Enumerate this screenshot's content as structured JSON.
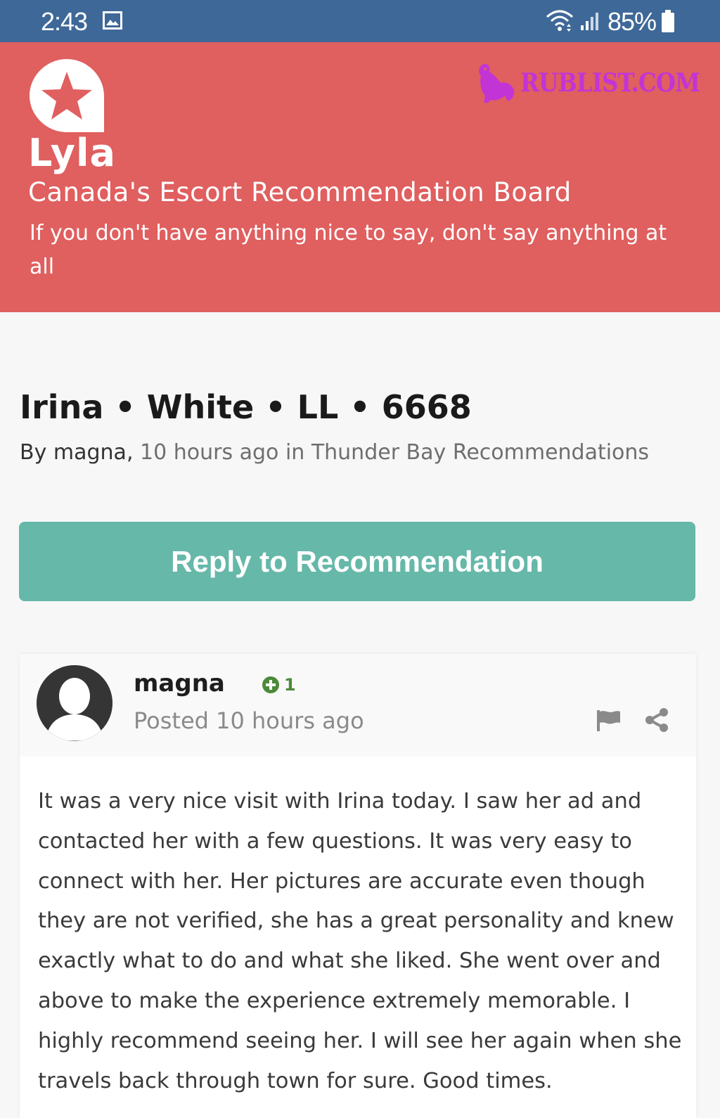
{
  "status_bar": {
    "time": "2:43",
    "battery": "85%",
    "background_color": "#3e6898",
    "icons": [
      "image-notification-icon",
      "wifi-icon",
      "signal-icon",
      "battery-icon"
    ]
  },
  "header": {
    "app_name": "Lyla",
    "tagline": "Canada's Escort Recommendation Board",
    "motto": "If you don't have anything nice to say, don't say anything at all",
    "background_color": "#e05f5f",
    "logo_icon": "star-badge-icon",
    "watermark": "RUBLIST.COM",
    "watermark_color": "#c234d6"
  },
  "topic": {
    "title": "Irina • White • LL • 6668",
    "by_label": "By",
    "author": "magna,",
    "meta": "10 hours ago in Thunder Bay Recommendations"
  },
  "reply_button": {
    "label": "Reply to Recommendation",
    "color": "#66b8a9"
  },
  "post": {
    "author": "magna",
    "reputation": "1",
    "reputation_color": "#4c8a3a",
    "posted": "Posted 10 hours ago",
    "body": "It was a very nice visit with Irina today. I saw her ad and contacted her with a few questions. It was very easy to connect with her. Her pictures are accurate even though they are not verified, she has a great personality and knew exactly what to do and what she liked. She went over and above to make the experience extremely memorable. I highly recommend seeing her. I will see her again when she travels back through town for sure. Good times.",
    "icons": [
      "avatar-icon",
      "plus-circle-icon",
      "flag-icon",
      "share-icon"
    ]
  }
}
